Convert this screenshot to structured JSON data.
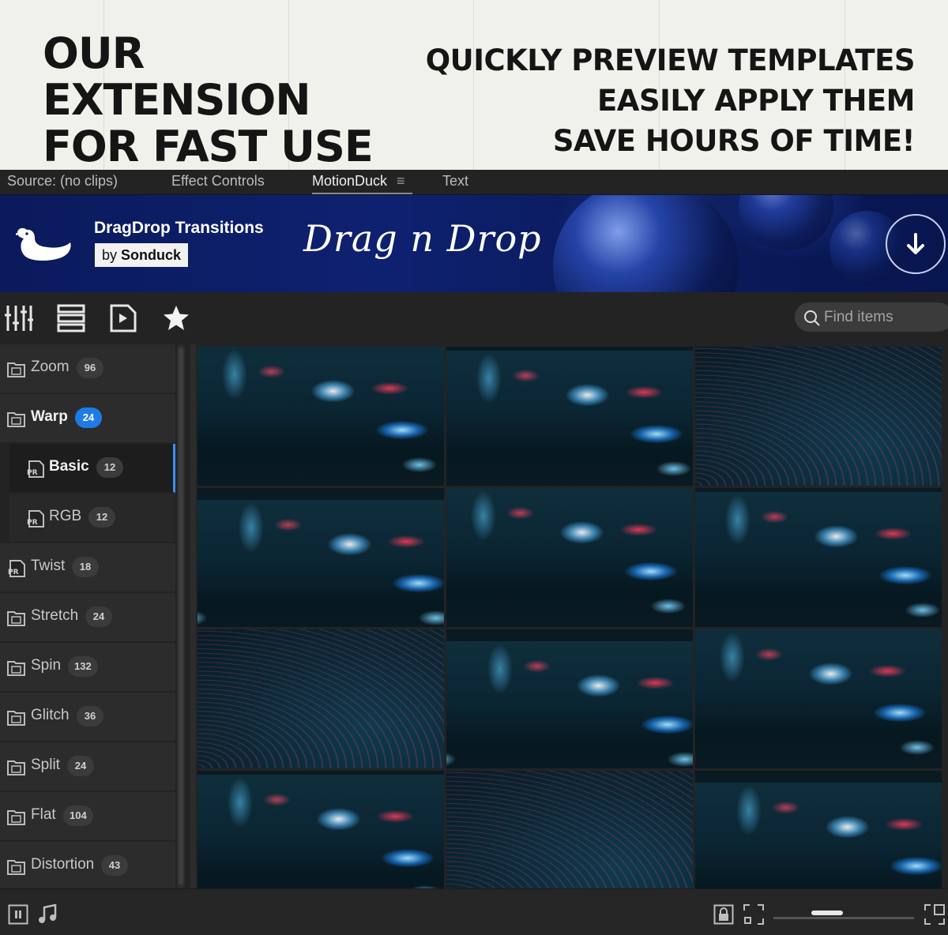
{
  "promo": {
    "left_lines": [
      "OUR",
      "EXTENSION",
      "FOR FAST USE"
    ],
    "right_lines": [
      "QUICKLY PREVIEW TEMPLATES",
      "EASILY APPLY THEM",
      "SAVE HOURS OF TIME!"
    ]
  },
  "tabs": [
    {
      "label": "Source: (no clips)"
    },
    {
      "label": "Effect Controls"
    },
    {
      "label": "MotionDuck",
      "active": true
    },
    {
      "label": "Text"
    }
  ],
  "banner": {
    "title": "DragDrop Transitions",
    "by_prefix": "by",
    "by_name": "Sonduck",
    "script_logo": "Drag n Drop"
  },
  "toolbar": {
    "icons": [
      "sliders-icon",
      "list-layout-icon",
      "media-file-icon",
      "star-icon"
    ],
    "search_placeholder": "Find items"
  },
  "sidebar": {
    "categories": [
      {
        "label": "Zoom",
        "count": "96",
        "icon": "folder-icon"
      },
      {
        "label": "Warp",
        "count": "24",
        "icon": "folder-icon",
        "expanded": true
      },
      {
        "label": "Basic",
        "count": "12",
        "icon": "premiere-file-icon",
        "sub": true,
        "selected": true
      },
      {
        "label": "RGB",
        "count": "12",
        "icon": "premiere-file-icon",
        "sub": true
      },
      {
        "label": "Twist",
        "count": "18",
        "icon": "premiere-file-icon"
      },
      {
        "label": "Stretch",
        "count": "24",
        "icon": "folder-icon"
      },
      {
        "label": "Spin",
        "count": "132",
        "icon": "folder-icon"
      },
      {
        "label": "Glitch",
        "count": "36",
        "icon": "folder-icon"
      },
      {
        "label": "Split",
        "count": "24",
        "icon": "folder-icon"
      },
      {
        "label": "Flat",
        "count": "104",
        "icon": "folder-icon"
      },
      {
        "label": "Distortion",
        "count": "43",
        "icon": "folder-icon"
      }
    ]
  },
  "grid": {
    "thumbnails": [
      {
        "style": "city"
      },
      {
        "style": "city"
      },
      {
        "style": "lines"
      },
      {
        "style": "city"
      },
      {
        "style": "city"
      },
      {
        "style": "city"
      },
      {
        "style": "lines"
      },
      {
        "style": "city"
      },
      {
        "style": "city"
      },
      {
        "style": "city"
      },
      {
        "style": "lines"
      },
      {
        "style": "city"
      }
    ]
  },
  "bottombar": {
    "left_icons": [
      "pause-icon",
      "music-note-icon"
    ],
    "right_icons": [
      "lock-icon",
      "small-grid-icon",
      "large-grid-icon"
    ],
    "zoom_level": 0.35
  },
  "colors": {
    "accent": "#1e7be6",
    "panel_bg": "#232323",
    "promo_bg": "#f1f1ec"
  }
}
